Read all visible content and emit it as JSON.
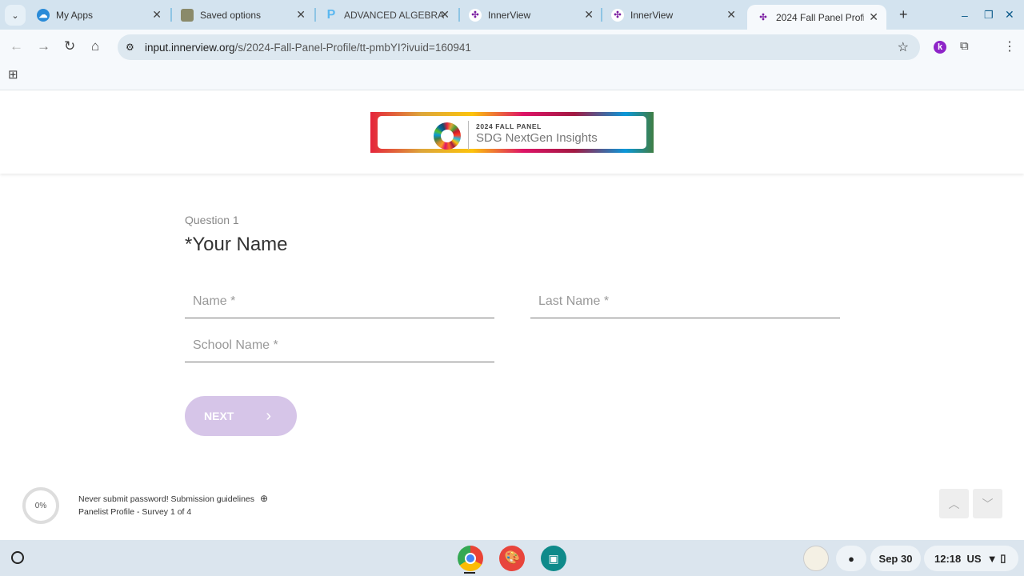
{
  "browser": {
    "tabs": [
      {
        "title": "My Apps",
        "active": false
      },
      {
        "title": "Saved options",
        "active": false
      },
      {
        "title": "ADVANCED ALGEBRA",
        "active": false
      },
      {
        "title": "InnerView",
        "active": false
      },
      {
        "title": "InnerView",
        "active": false
      },
      {
        "title": "2024 Fall Panel Profile",
        "active": true
      }
    ],
    "url_host": "input.innerview.org",
    "url_path": "/s/2024-Fall-Panel-Profile/tt-pmbYI?ivuid=160941",
    "extension_letter": "k"
  },
  "banner": {
    "line1": "2024 FALL PANEL",
    "line2": "SDG NextGen Insights"
  },
  "question": {
    "number": "Question 1",
    "title": "*Your Name",
    "fields": {
      "first_placeholder": "Name *",
      "last_placeholder": "Last Name *",
      "school_placeholder": "School Name *"
    },
    "next_label": "NEXT"
  },
  "footer": {
    "progress_percent": "0%",
    "guidelines": "Never submit password! Submission guidelines",
    "survey_info": "Panelist Profile - Survey 1 of 4"
  },
  "shelf": {
    "date": "Sep 30",
    "time": "12:18",
    "locale": "US"
  },
  "colors": {
    "accent": "#7b1fa2",
    "next_disabled": "#d6c5e8"
  }
}
